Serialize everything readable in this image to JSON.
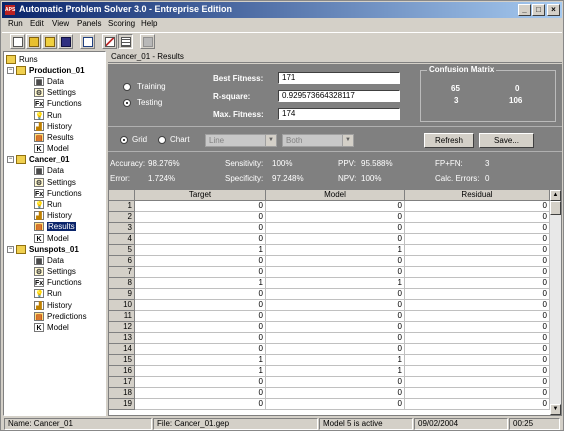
{
  "app": {
    "title": "Automatic Problem Solver 3.0 - Entreprise Edition",
    "icon_text": "APS"
  },
  "window_buttons": {
    "minimize": "_",
    "maximize": "□",
    "close": "×"
  },
  "menu": [
    "Run",
    "Edit",
    "View",
    "Panels",
    "Scoring",
    "Help"
  ],
  "toolbar_icons": [
    "new-icon",
    "open-icon",
    "open-folder-icon",
    "save-icon",
    "copy-icon",
    "chart-icon",
    "grid-icon",
    "disabled-icon"
  ],
  "tree": {
    "root": "Runs",
    "runs": [
      {
        "name": "Production_01",
        "items": [
          "Data",
          "Settings",
          "Functions",
          "Run",
          "History",
          "Results",
          "Model"
        ]
      },
      {
        "name": "Cancer_01",
        "items": [
          "Data",
          "Settings",
          "Functions",
          "Run",
          "History",
          "Results",
          "Model"
        ],
        "selected": "Results"
      },
      {
        "name": "Sunspots_01",
        "items": [
          "Data",
          "Settings",
          "Functions",
          "Run",
          "History",
          "Predictions",
          "Model"
        ]
      }
    ]
  },
  "content_title": "Cancer_01 - Results",
  "mode": {
    "training": "Training",
    "testing": "Testing",
    "selected": "Testing"
  },
  "fitness": {
    "best_label": "Best Fitness:",
    "best_value": "171",
    "rsq_label": "R-square:",
    "rsq_value": "0.929573664328117",
    "max_label": "Max. Fitness:",
    "max_value": "174"
  },
  "confusion": {
    "title": "Confusion Matrix",
    "tp": "65",
    "fp": "0",
    "fn": "3",
    "tn": "106"
  },
  "view": {
    "grid": "Grid",
    "chart": "Chart",
    "selected": "Grid",
    "combo1": "Line",
    "combo2": "Both",
    "refresh": "Refresh",
    "save": "Save..."
  },
  "stats": {
    "accuracy_label": "Accuracy:",
    "accuracy_value": "98.276%",
    "error_label": "Error:",
    "error_value": "1.724%",
    "sensitivity_label": "Sensitivity:",
    "sensitivity_value": "100%",
    "specificity_label": "Specificity:",
    "specificity_value": "97.248%",
    "ppv_label": "PPV:",
    "ppv_value": "95.588%",
    "npv_label": "NPV:",
    "npv_value": "100%",
    "fpfn_label": "FP+FN:",
    "fpfn_value": "3",
    "calcerr_label": "Calc. Errors:",
    "calcerr_value": "0"
  },
  "grid": {
    "columns": [
      "Target",
      "Model",
      "Residual"
    ],
    "rows": [
      {
        "n": "1",
        "target": "0",
        "model": "0",
        "residual": "0"
      },
      {
        "n": "2",
        "target": "0",
        "model": "0",
        "residual": "0"
      },
      {
        "n": "3",
        "target": "0",
        "model": "0",
        "residual": "0"
      },
      {
        "n": "4",
        "target": "0",
        "model": "0",
        "residual": "0"
      },
      {
        "n": "5",
        "target": "1",
        "model": "1",
        "residual": "0"
      },
      {
        "n": "6",
        "target": "0",
        "model": "0",
        "residual": "0"
      },
      {
        "n": "7",
        "target": "0",
        "model": "0",
        "residual": "0"
      },
      {
        "n": "8",
        "target": "1",
        "model": "1",
        "residual": "0"
      },
      {
        "n": "9",
        "target": "0",
        "model": "0",
        "residual": "0"
      },
      {
        "n": "10",
        "target": "0",
        "model": "0",
        "residual": "0"
      },
      {
        "n": "11",
        "target": "0",
        "model": "0",
        "residual": "0"
      },
      {
        "n": "12",
        "target": "0",
        "model": "0",
        "residual": "0"
      },
      {
        "n": "13",
        "target": "0",
        "model": "0",
        "residual": "0"
      },
      {
        "n": "14",
        "target": "0",
        "model": "0",
        "residual": "0"
      },
      {
        "n": "15",
        "target": "1",
        "model": "1",
        "residual": "0"
      },
      {
        "n": "16",
        "target": "1",
        "model": "1",
        "residual": "0"
      },
      {
        "n": "17",
        "target": "0",
        "model": "0",
        "residual": "0"
      },
      {
        "n": "18",
        "target": "0",
        "model": "0",
        "residual": "0"
      },
      {
        "n": "19",
        "target": "0",
        "model": "0",
        "residual": "0"
      }
    ]
  },
  "status": {
    "name": "Name: Cancer_01",
    "file": "File: Cancer_01.gep",
    "model": "Model 5 is active",
    "date": "09/02/2004",
    "time": "00:25"
  }
}
